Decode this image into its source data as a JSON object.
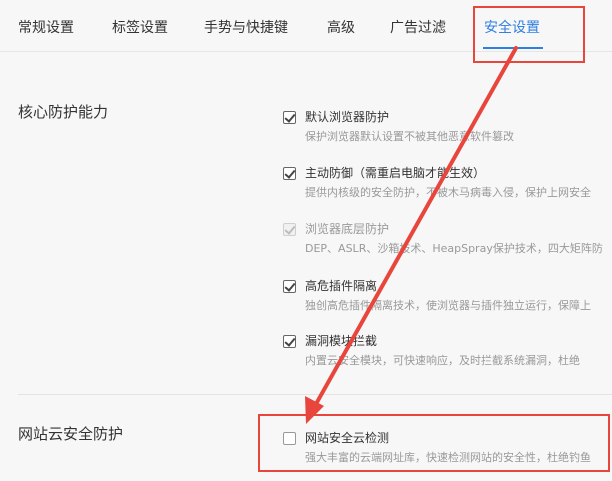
{
  "tabs": [
    {
      "label": "常规设置",
      "active": false
    },
    {
      "label": "标签设置",
      "active": false
    },
    {
      "label": "手势与快捷键",
      "active": false
    },
    {
      "label": "高级",
      "active": false
    },
    {
      "label": "广告过滤",
      "active": false
    },
    {
      "label": "安全设置",
      "active": true
    }
  ],
  "sections": {
    "core": {
      "title": "核心防护能力",
      "options": [
        {
          "label": "默认浏览器防护",
          "desc": "保护浏览器默认设置不被其他恶意软件篡改",
          "checked": true,
          "disabled": false
        },
        {
          "label": "主动防御（需重启电脑才能生效）",
          "desc": "提供内核级的安全防护，不被木马病毒入侵，保护上网安全",
          "checked": true,
          "disabled": false
        },
        {
          "label": "浏览器底层防护",
          "desc": "DEP、ASLR、沙箱技术、HeapSpray保护技术，四大矩阵防",
          "checked": true,
          "disabled": true
        },
        {
          "label": "高危插件隔离",
          "desc": "独创高危插件隔离技术，使浏览器与插件独立运行，保障上",
          "checked": true,
          "disabled": false
        },
        {
          "label": "漏洞模块拦截",
          "desc": "内置云安全模块，可快速响应，及时拦截系统漏洞，杜绝",
          "checked": true,
          "disabled": false
        }
      ]
    },
    "web": {
      "title": "网站云安全防护",
      "options": [
        {
          "label": "网站安全云检测",
          "desc": "强大丰富的云端网址库，快速检测网站的安全性，杜绝钓鱼",
          "checked": false,
          "disabled": false
        }
      ]
    }
  },
  "colors": {
    "accent": "#2f7fe0",
    "annotation": "#e8463c"
  }
}
